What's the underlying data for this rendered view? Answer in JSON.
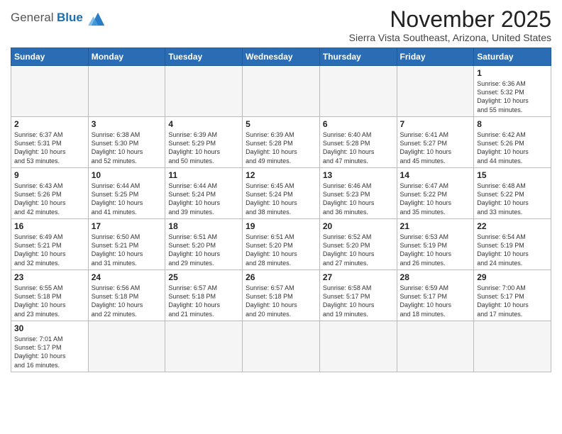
{
  "header": {
    "logo_general": "General",
    "logo_blue": "Blue",
    "month_title": "November 2025",
    "location": "Sierra Vista Southeast, Arizona, United States"
  },
  "weekdays": [
    "Sunday",
    "Monday",
    "Tuesday",
    "Wednesday",
    "Thursday",
    "Friday",
    "Saturday"
  ],
  "weeks": [
    [
      {
        "day": "",
        "info": ""
      },
      {
        "day": "",
        "info": ""
      },
      {
        "day": "",
        "info": ""
      },
      {
        "day": "",
        "info": ""
      },
      {
        "day": "",
        "info": ""
      },
      {
        "day": "",
        "info": ""
      },
      {
        "day": "1",
        "info": "Sunrise: 6:36 AM\nSunset: 5:32 PM\nDaylight: 10 hours\nand 55 minutes."
      }
    ],
    [
      {
        "day": "2",
        "info": "Sunrise: 6:37 AM\nSunset: 5:31 PM\nDaylight: 10 hours\nand 53 minutes."
      },
      {
        "day": "3",
        "info": "Sunrise: 6:38 AM\nSunset: 5:30 PM\nDaylight: 10 hours\nand 52 minutes."
      },
      {
        "day": "4",
        "info": "Sunrise: 6:39 AM\nSunset: 5:29 PM\nDaylight: 10 hours\nand 50 minutes."
      },
      {
        "day": "5",
        "info": "Sunrise: 6:39 AM\nSunset: 5:28 PM\nDaylight: 10 hours\nand 49 minutes."
      },
      {
        "day": "6",
        "info": "Sunrise: 6:40 AM\nSunset: 5:28 PM\nDaylight: 10 hours\nand 47 minutes."
      },
      {
        "day": "7",
        "info": "Sunrise: 6:41 AM\nSunset: 5:27 PM\nDaylight: 10 hours\nand 45 minutes."
      },
      {
        "day": "8",
        "info": "Sunrise: 6:42 AM\nSunset: 5:26 PM\nDaylight: 10 hours\nand 44 minutes."
      }
    ],
    [
      {
        "day": "9",
        "info": "Sunrise: 6:43 AM\nSunset: 5:26 PM\nDaylight: 10 hours\nand 42 minutes."
      },
      {
        "day": "10",
        "info": "Sunrise: 6:44 AM\nSunset: 5:25 PM\nDaylight: 10 hours\nand 41 minutes."
      },
      {
        "day": "11",
        "info": "Sunrise: 6:44 AM\nSunset: 5:24 PM\nDaylight: 10 hours\nand 39 minutes."
      },
      {
        "day": "12",
        "info": "Sunrise: 6:45 AM\nSunset: 5:24 PM\nDaylight: 10 hours\nand 38 minutes."
      },
      {
        "day": "13",
        "info": "Sunrise: 6:46 AM\nSunset: 5:23 PM\nDaylight: 10 hours\nand 36 minutes."
      },
      {
        "day": "14",
        "info": "Sunrise: 6:47 AM\nSunset: 5:22 PM\nDaylight: 10 hours\nand 35 minutes."
      },
      {
        "day": "15",
        "info": "Sunrise: 6:48 AM\nSunset: 5:22 PM\nDaylight: 10 hours\nand 33 minutes."
      }
    ],
    [
      {
        "day": "16",
        "info": "Sunrise: 6:49 AM\nSunset: 5:21 PM\nDaylight: 10 hours\nand 32 minutes."
      },
      {
        "day": "17",
        "info": "Sunrise: 6:50 AM\nSunset: 5:21 PM\nDaylight: 10 hours\nand 31 minutes."
      },
      {
        "day": "18",
        "info": "Sunrise: 6:51 AM\nSunset: 5:20 PM\nDaylight: 10 hours\nand 29 minutes."
      },
      {
        "day": "19",
        "info": "Sunrise: 6:51 AM\nSunset: 5:20 PM\nDaylight: 10 hours\nand 28 minutes."
      },
      {
        "day": "20",
        "info": "Sunrise: 6:52 AM\nSunset: 5:20 PM\nDaylight: 10 hours\nand 27 minutes."
      },
      {
        "day": "21",
        "info": "Sunrise: 6:53 AM\nSunset: 5:19 PM\nDaylight: 10 hours\nand 26 minutes."
      },
      {
        "day": "22",
        "info": "Sunrise: 6:54 AM\nSunset: 5:19 PM\nDaylight: 10 hours\nand 24 minutes."
      }
    ],
    [
      {
        "day": "23",
        "info": "Sunrise: 6:55 AM\nSunset: 5:18 PM\nDaylight: 10 hours\nand 23 minutes."
      },
      {
        "day": "24",
        "info": "Sunrise: 6:56 AM\nSunset: 5:18 PM\nDaylight: 10 hours\nand 22 minutes."
      },
      {
        "day": "25",
        "info": "Sunrise: 6:57 AM\nSunset: 5:18 PM\nDaylight: 10 hours\nand 21 minutes."
      },
      {
        "day": "26",
        "info": "Sunrise: 6:57 AM\nSunset: 5:18 PM\nDaylight: 10 hours\nand 20 minutes."
      },
      {
        "day": "27",
        "info": "Sunrise: 6:58 AM\nSunset: 5:17 PM\nDaylight: 10 hours\nand 19 minutes."
      },
      {
        "day": "28",
        "info": "Sunrise: 6:59 AM\nSunset: 5:17 PM\nDaylight: 10 hours\nand 18 minutes."
      },
      {
        "day": "29",
        "info": "Sunrise: 7:00 AM\nSunset: 5:17 PM\nDaylight: 10 hours\nand 17 minutes."
      }
    ],
    [
      {
        "day": "30",
        "info": "Sunrise: 7:01 AM\nSunset: 5:17 PM\nDaylight: 10 hours\nand 16 minutes."
      },
      {
        "day": "",
        "info": ""
      },
      {
        "day": "",
        "info": ""
      },
      {
        "day": "",
        "info": ""
      },
      {
        "day": "",
        "info": ""
      },
      {
        "day": "",
        "info": ""
      },
      {
        "day": "",
        "info": ""
      }
    ]
  ]
}
